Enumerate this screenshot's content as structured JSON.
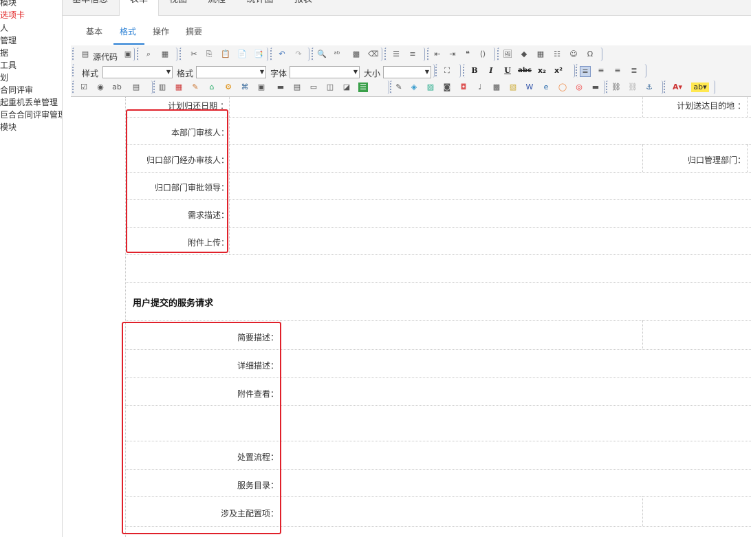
{
  "sidebar": {
    "items": [
      {
        "label": "模块",
        "active": false
      },
      {
        "label": "选项卡",
        "active": true
      },
      {
        "label": "人",
        "active": false
      },
      {
        "label": "管理",
        "active": false
      },
      {
        "label": "据",
        "active": false
      },
      {
        "label": "工具",
        "active": false
      },
      {
        "label": "划",
        "active": false
      },
      {
        "label": "合同评审",
        "active": false
      },
      {
        "label": "起重机丢单管理",
        "active": false
      },
      {
        "label": "巨合合同评审管理",
        "active": false
      },
      {
        "label": "模块",
        "active": false
      }
    ]
  },
  "top_tabs": [
    {
      "label": "基本信息",
      "active": false
    },
    {
      "label": "表单",
      "active": true
    },
    {
      "label": "视图",
      "active": false
    },
    {
      "label": "流程",
      "active": false
    },
    {
      "label": "统计图",
      "active": false
    },
    {
      "label": "报表",
      "active": false
    }
  ],
  "sub_tabs": [
    {
      "label": "基本",
      "active": false
    },
    {
      "label": "格式",
      "active": true
    },
    {
      "label": "操作",
      "active": false
    },
    {
      "label": "摘要",
      "active": false
    }
  ],
  "toolbar": {
    "source_label": "源代码",
    "style_label": "样式",
    "format_label": "格式",
    "font_label": "字体",
    "size_label": "大小",
    "style_value": "",
    "format_value": "",
    "font_value": "",
    "size_value": ""
  },
  "form": {
    "top_fields": {
      "return_date": "计划归还日期 ：",
      "destination": "计划送达目的地 ："
    },
    "group1": [
      "本部门审核人：",
      "归口部门经办审核人：",
      "归口部门审批领导：",
      "需求描述：",
      "附件上传："
    ],
    "managing_dept": "归口管理部门：",
    "section_title": "用户提交的服务请求",
    "group2": [
      "简要描述：",
      "详细描述：",
      "附件查看：",
      "处置流程：",
      "服务目录：",
      "涉及主配置项："
    ]
  },
  "colors": {
    "accent": "#2a7fd4",
    "sidebar_active": "#e02020",
    "highlight_box": "#e0202a"
  }
}
